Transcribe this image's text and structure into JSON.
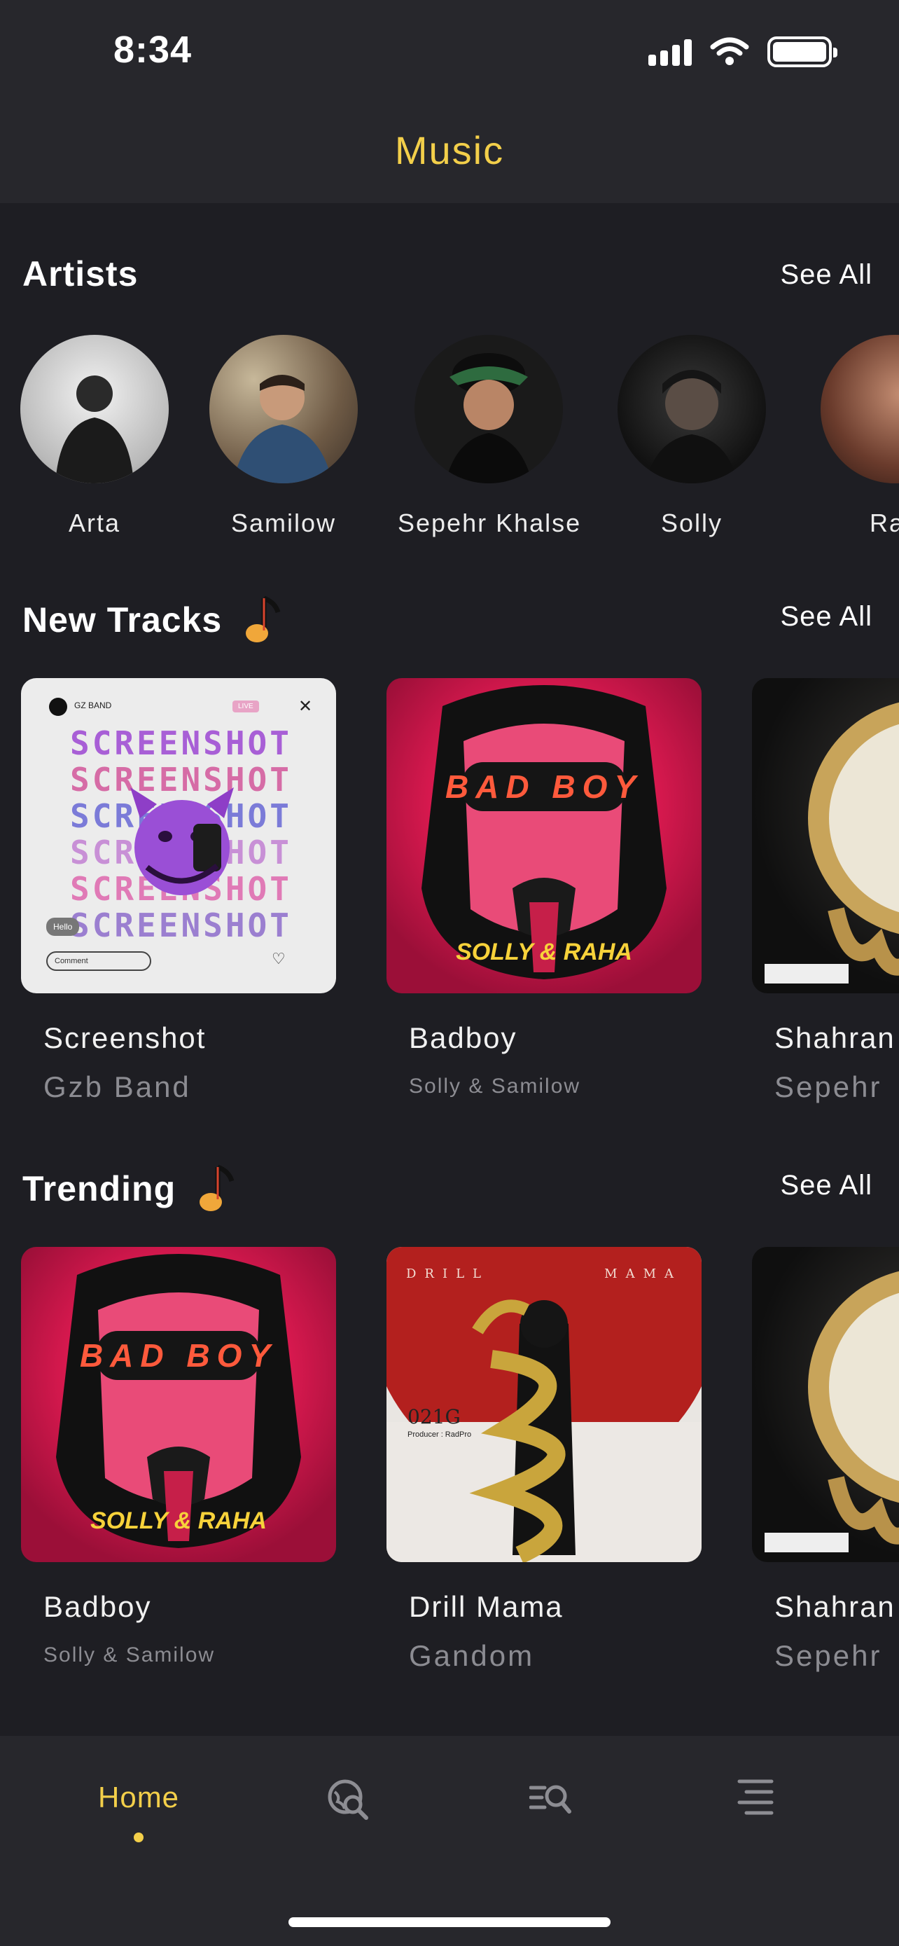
{
  "status_bar": {
    "time": "8:34"
  },
  "header": {
    "title": "Music"
  },
  "artists_section": {
    "title": "Artists",
    "see_all": "See All",
    "items": [
      {
        "name": "Arta"
      },
      {
        "name": "Samilow"
      },
      {
        "name": "Sepehr Khalse"
      },
      {
        "name": "Solly"
      },
      {
        "name": "Rah"
      }
    ]
  },
  "new_tracks": {
    "title": "New Tracks",
    "see_all": "See All",
    "items": [
      {
        "title": "Screenshot",
        "artist": "Gzb Band"
      },
      {
        "title": "Badboy",
        "artist": "Solly & Samilow"
      },
      {
        "title": "Shahran",
        "artist": "Sepehr"
      }
    ]
  },
  "trending": {
    "title": "Trending",
    "see_all": "See All",
    "items": [
      {
        "title": "Badboy",
        "artist": "Solly & Samilow"
      },
      {
        "title": "Drill Mama",
        "artist": "Gandom"
      },
      {
        "title": "Shahran",
        "artist": "Sepehr"
      }
    ]
  },
  "cover_art": {
    "screenshot": {
      "band": "GZ BAND",
      "word": "SCREENSHOT",
      "comment_placeholder": "Comment",
      "hello": "Hello",
      "live": "LIVE"
    },
    "badboy": {
      "top": "BAD BOY",
      "bottom": "SOLLY & RAHA"
    },
    "drill": {
      "left": "DRILL",
      "right": "MAMA",
      "label": "021G",
      "producer": "Producer : RadPro"
    }
  },
  "tab_bar": {
    "home_label": "Home",
    "icons": [
      "explore-icon",
      "search-list-icon",
      "menu-icon"
    ]
  },
  "colors": {
    "accent": "#f3cf4a",
    "background": "#1e1e23",
    "bar": "#27272c"
  }
}
